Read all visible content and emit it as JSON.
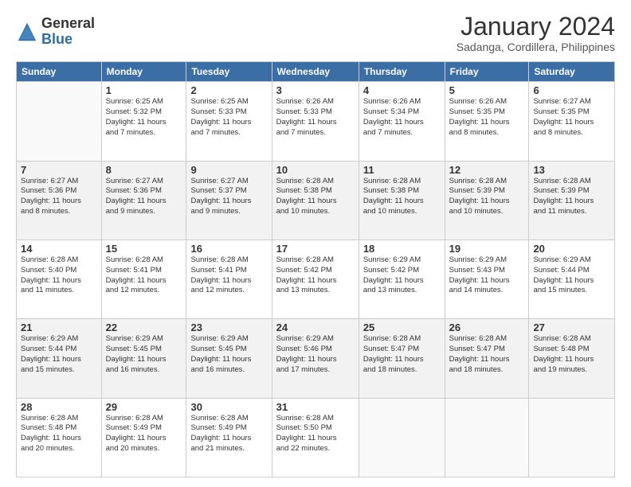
{
  "logo": {
    "general": "General",
    "blue": "Blue"
  },
  "title": "January 2024",
  "subtitle": "Sadanga, Cordillera, Philippines",
  "weekdays": [
    "Sunday",
    "Monday",
    "Tuesday",
    "Wednesday",
    "Thursday",
    "Friday",
    "Saturday"
  ],
  "weeks": [
    [
      {
        "day": "",
        "info": ""
      },
      {
        "day": "1",
        "info": "Sunrise: 6:25 AM\nSunset: 5:32 PM\nDaylight: 11 hours\nand 7 minutes."
      },
      {
        "day": "2",
        "info": "Sunrise: 6:25 AM\nSunset: 5:33 PM\nDaylight: 11 hours\nand 7 minutes."
      },
      {
        "day": "3",
        "info": "Sunrise: 6:26 AM\nSunset: 5:33 PM\nDaylight: 11 hours\nand 7 minutes."
      },
      {
        "day": "4",
        "info": "Sunrise: 6:26 AM\nSunset: 5:34 PM\nDaylight: 11 hours\nand 7 minutes."
      },
      {
        "day": "5",
        "info": "Sunrise: 6:26 AM\nSunset: 5:35 PM\nDaylight: 11 hours\nand 8 minutes."
      },
      {
        "day": "6",
        "info": "Sunrise: 6:27 AM\nSunset: 5:35 PM\nDaylight: 11 hours\nand 8 minutes."
      }
    ],
    [
      {
        "day": "7",
        "info": "Sunrise: 6:27 AM\nSunset: 5:36 PM\nDaylight: 11 hours\nand 8 minutes."
      },
      {
        "day": "8",
        "info": "Sunrise: 6:27 AM\nSunset: 5:36 PM\nDaylight: 11 hours\nand 9 minutes."
      },
      {
        "day": "9",
        "info": "Sunrise: 6:27 AM\nSunset: 5:37 PM\nDaylight: 11 hours\nand 9 minutes."
      },
      {
        "day": "10",
        "info": "Sunrise: 6:28 AM\nSunset: 5:38 PM\nDaylight: 11 hours\nand 10 minutes."
      },
      {
        "day": "11",
        "info": "Sunrise: 6:28 AM\nSunset: 5:38 PM\nDaylight: 11 hours\nand 10 minutes."
      },
      {
        "day": "12",
        "info": "Sunrise: 6:28 AM\nSunset: 5:39 PM\nDaylight: 11 hours\nand 10 minutes."
      },
      {
        "day": "13",
        "info": "Sunrise: 6:28 AM\nSunset: 5:39 PM\nDaylight: 11 hours\nand 11 minutes."
      }
    ],
    [
      {
        "day": "14",
        "info": "Sunrise: 6:28 AM\nSunset: 5:40 PM\nDaylight: 11 hours\nand 11 minutes."
      },
      {
        "day": "15",
        "info": "Sunrise: 6:28 AM\nSunset: 5:41 PM\nDaylight: 11 hours\nand 12 minutes."
      },
      {
        "day": "16",
        "info": "Sunrise: 6:28 AM\nSunset: 5:41 PM\nDaylight: 11 hours\nand 12 minutes."
      },
      {
        "day": "17",
        "info": "Sunrise: 6:28 AM\nSunset: 5:42 PM\nDaylight: 11 hours\nand 13 minutes."
      },
      {
        "day": "18",
        "info": "Sunrise: 6:29 AM\nSunset: 5:42 PM\nDaylight: 11 hours\nand 13 minutes."
      },
      {
        "day": "19",
        "info": "Sunrise: 6:29 AM\nSunset: 5:43 PM\nDaylight: 11 hours\nand 14 minutes."
      },
      {
        "day": "20",
        "info": "Sunrise: 6:29 AM\nSunset: 5:44 PM\nDaylight: 11 hours\nand 15 minutes."
      }
    ],
    [
      {
        "day": "21",
        "info": "Sunrise: 6:29 AM\nSunset: 5:44 PM\nDaylight: 11 hours\nand 15 minutes."
      },
      {
        "day": "22",
        "info": "Sunrise: 6:29 AM\nSunset: 5:45 PM\nDaylight: 11 hours\nand 16 minutes."
      },
      {
        "day": "23",
        "info": "Sunrise: 6:29 AM\nSunset: 5:45 PM\nDaylight: 11 hours\nand 16 minutes."
      },
      {
        "day": "24",
        "info": "Sunrise: 6:29 AM\nSunset: 5:46 PM\nDaylight: 11 hours\nand 17 minutes."
      },
      {
        "day": "25",
        "info": "Sunrise: 6:28 AM\nSunset: 5:47 PM\nDaylight: 11 hours\nand 18 minutes."
      },
      {
        "day": "26",
        "info": "Sunrise: 6:28 AM\nSunset: 5:47 PM\nDaylight: 11 hours\nand 18 minutes."
      },
      {
        "day": "27",
        "info": "Sunrise: 6:28 AM\nSunset: 5:48 PM\nDaylight: 11 hours\nand 19 minutes."
      }
    ],
    [
      {
        "day": "28",
        "info": "Sunrise: 6:28 AM\nSunset: 5:48 PM\nDaylight: 11 hours\nand 20 minutes."
      },
      {
        "day": "29",
        "info": "Sunrise: 6:28 AM\nSunset: 5:49 PM\nDaylight: 11 hours\nand 20 minutes."
      },
      {
        "day": "30",
        "info": "Sunrise: 6:28 AM\nSunset: 5:49 PM\nDaylight: 11 hours\nand 21 minutes."
      },
      {
        "day": "31",
        "info": "Sunrise: 6:28 AM\nSunset: 5:50 PM\nDaylight: 11 hours\nand 22 minutes."
      },
      {
        "day": "",
        "info": ""
      },
      {
        "day": "",
        "info": ""
      },
      {
        "day": "",
        "info": ""
      }
    ]
  ]
}
